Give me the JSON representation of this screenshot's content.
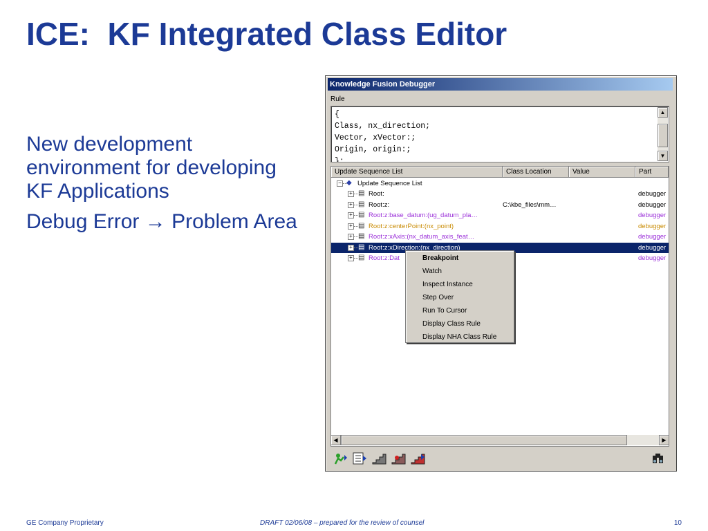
{
  "slide": {
    "title": "ICE:  KF Integrated Class Editor",
    "bullets": [
      "New development environment for developing KF Applications",
      {
        "before": "Debug Error ",
        "arrow": "→",
        "after": " Problem Area"
      }
    ],
    "footer": {
      "left": "GE Company Proprietary",
      "center": "DRAFT 02/06/08 – prepared for the review of counsel",
      "right": "10"
    }
  },
  "window": {
    "title": "Knowledge Fusion Debugger",
    "rule_label": "Rule",
    "rule_code": "{\nClass, nx_direction;\nVector, xVector:;\nOrigin, origin:;\n};",
    "columns": [
      "Update Sequence List",
      "Class Location",
      "Value",
      "Part"
    ],
    "root_label": "Update Sequence List",
    "rows": [
      {
        "name": "Root:",
        "location": "",
        "part": "debugger",
        "color": "#000000"
      },
      {
        "name": "Root:z:",
        "location": "C:\\kbe_files\\mm…",
        "part": "debugger",
        "color": "#000000"
      },
      {
        "name": "Root:z:base_datum:(ug_datum_pla…",
        "location": "",
        "part": "debugger",
        "color": "#9b30d9"
      },
      {
        "name": "Root:z:centerPoint:(nx_point)",
        "location": "",
        "part": "debugger",
        "color": "#c88a00"
      },
      {
        "name": "Root:z:xAxis:(nx_datum_axis_feat…",
        "location": "",
        "part": "debugger",
        "color": "#9b30d9"
      },
      {
        "name": "Root:z:xDirection:(nx_direction)",
        "location": "",
        "part": "debugger",
        "color": "#ffffff",
        "selected": true
      },
      {
        "name": "Root:z:Dat",
        "location": "",
        "part": "debugger",
        "color": "#9b30d9"
      }
    ],
    "toolbar_icons": [
      "run-icon",
      "step-list-icon",
      "step-icon",
      "step-into-icon",
      "step-out-icon",
      "find-icon"
    ]
  },
  "context_menu": {
    "items": [
      {
        "label": "Breakpoint",
        "bold": true
      },
      {
        "label": "Watch"
      },
      {
        "label": "Inspect Instance"
      },
      {
        "label": "Step Over"
      },
      {
        "label": "Run To Cursor"
      },
      {
        "label": "Display Class Rule"
      },
      {
        "label": "Display NHA Class Rule"
      }
    ]
  },
  "colors": {
    "slide_text": "#1c3a96",
    "titlebar_start": "#0a246a",
    "titlebar_end": "#a6caf0",
    "selection": "#0a246a"
  }
}
